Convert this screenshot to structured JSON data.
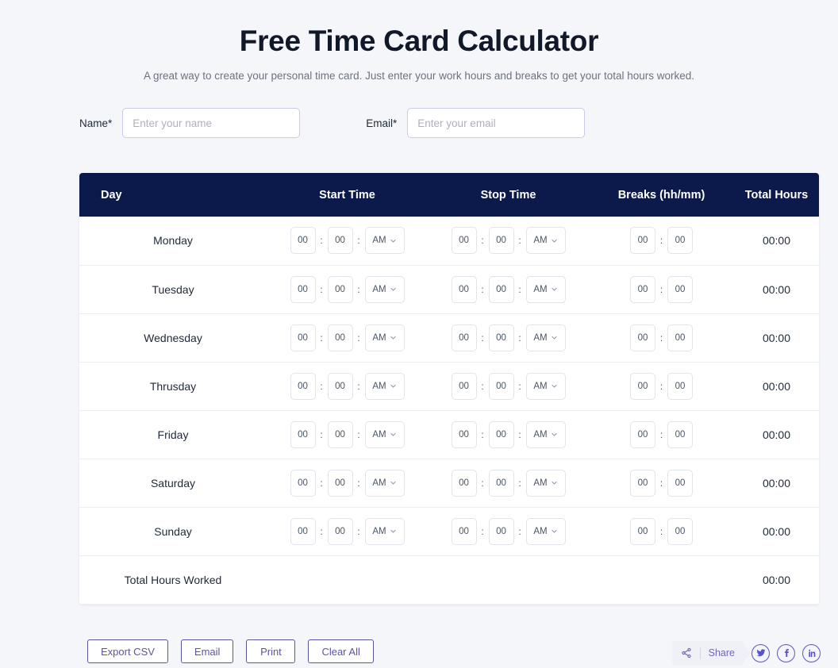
{
  "header": {
    "title": "Free Time Card Calculator",
    "subtitle": "A great way to create your personal time card. Just enter your work hours and breaks to get your total hours worked."
  },
  "form": {
    "name_label": "Name*",
    "name_placeholder": "Enter your name",
    "name_value": "",
    "email_label": "Email*",
    "email_placeholder": "Enter your email",
    "email_value": ""
  },
  "table": {
    "columns": {
      "day": "Day",
      "start": "Start Time",
      "stop": "Stop Time",
      "breaks": "Breaks (hh/mm)",
      "total": "Total Hours"
    },
    "separator": ":",
    "rows": [
      {
        "day": "Monday",
        "start": {
          "hh": "00",
          "mm": "00",
          "meridiem": "AM"
        },
        "stop": {
          "hh": "00",
          "mm": "00",
          "meridiem": "AM"
        },
        "breaks": {
          "hh": "00",
          "mm": "00"
        },
        "total": "00:00"
      },
      {
        "day": "Tuesday",
        "start": {
          "hh": "00",
          "mm": "00",
          "meridiem": "AM"
        },
        "stop": {
          "hh": "00",
          "mm": "00",
          "meridiem": "AM"
        },
        "breaks": {
          "hh": "00",
          "mm": "00"
        },
        "total": "00:00"
      },
      {
        "day": "Wednesday",
        "start": {
          "hh": "00",
          "mm": "00",
          "meridiem": "AM"
        },
        "stop": {
          "hh": "00",
          "mm": "00",
          "meridiem": "AM"
        },
        "breaks": {
          "hh": "00",
          "mm": "00"
        },
        "total": "00:00"
      },
      {
        "day": "Thrusday",
        "start": {
          "hh": "00",
          "mm": "00",
          "meridiem": "AM"
        },
        "stop": {
          "hh": "00",
          "mm": "00",
          "meridiem": "AM"
        },
        "breaks": {
          "hh": "00",
          "mm": "00"
        },
        "total": "00:00"
      },
      {
        "day": "Friday",
        "start": {
          "hh": "00",
          "mm": "00",
          "meridiem": "AM"
        },
        "stop": {
          "hh": "00",
          "mm": "00",
          "meridiem": "AM"
        },
        "breaks": {
          "hh": "00",
          "mm": "00"
        },
        "total": "00:00"
      },
      {
        "day": "Saturday",
        "start": {
          "hh": "00",
          "mm": "00",
          "meridiem": "AM"
        },
        "stop": {
          "hh": "00",
          "mm": "00",
          "meridiem": "AM"
        },
        "breaks": {
          "hh": "00",
          "mm": "00"
        },
        "total": "00:00"
      },
      {
        "day": "Sunday",
        "start": {
          "hh": "00",
          "mm": "00",
          "meridiem": "AM"
        },
        "stop": {
          "hh": "00",
          "mm": "00",
          "meridiem": "AM"
        },
        "breaks": {
          "hh": "00",
          "mm": "00"
        },
        "total": "00:00"
      }
    ],
    "total_row": {
      "label": "Total Hours Worked",
      "value": "00:00"
    }
  },
  "actions": {
    "export_csv": "Export CSV",
    "email": "Email",
    "print": "Print",
    "clear_all": "Clear All"
  },
  "share": {
    "label": "Share",
    "icons": [
      "share-nodes-icon",
      "twitter-icon",
      "facebook-icon",
      "linkedin-icon"
    ]
  },
  "colors": {
    "page_background": "#f5f6fa",
    "table_header": "#0b1a4a",
    "accent_button": "#5b53a6",
    "social": "#5b53c9",
    "title": "#111827",
    "subtitle": "#6b7280"
  }
}
